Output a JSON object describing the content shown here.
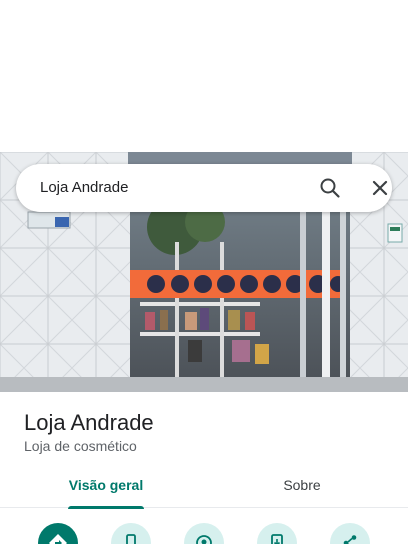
{
  "search": {
    "query": "Loja Andrade",
    "search_icon": "search-icon",
    "close_icon": "close-icon"
  },
  "place": {
    "name": "Loja Andrade",
    "category": "Loja de cosmético"
  },
  "tabs": [
    {
      "label": "Visão geral",
      "active": true
    },
    {
      "label": "Sobre",
      "active": false
    }
  ],
  "actions": [
    {
      "icon": "directions-icon"
    },
    {
      "icon": "phone-icon"
    },
    {
      "icon": "nearby-icon"
    },
    {
      "icon": "save-to-phone-icon"
    },
    {
      "icon": "share-icon"
    }
  ],
  "colors": {
    "accent": "#00796b",
    "action_bg": "#d6f0ee",
    "storefront_banner": "#f26b3a"
  }
}
